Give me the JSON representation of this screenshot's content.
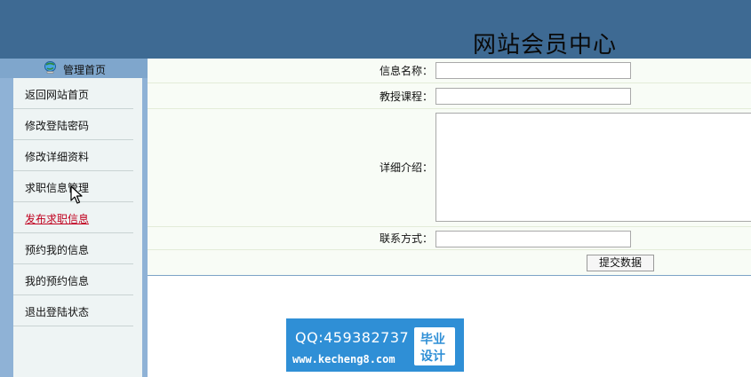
{
  "header": {
    "title": "网站会员中心"
  },
  "sidebar": {
    "head_label": "管理首页",
    "items": [
      {
        "label": "返回网站首页"
      },
      {
        "label": "修改登陆密码"
      },
      {
        "label": "修改详细资料"
      },
      {
        "label": "求职信息管理"
      },
      {
        "label": "发布求职信息"
      },
      {
        "label": "预约我的信息"
      },
      {
        "label": "我的预约信息"
      },
      {
        "label": "退出登陆状态"
      }
    ]
  },
  "form": {
    "name_label": "信息名称：",
    "name_value": "",
    "course_label": "教授课程：",
    "course_value": "",
    "detail_label": "详细介绍：",
    "detail_value": "",
    "contact_label": "联系方式：",
    "contact_value": "",
    "submit_label": "提交数据"
  },
  "watermark": {
    "qq": "QQ:459382737",
    "url": "www.kecheng8.com",
    "badge_line1": "毕业",
    "badge_line2": "设计"
  }
}
